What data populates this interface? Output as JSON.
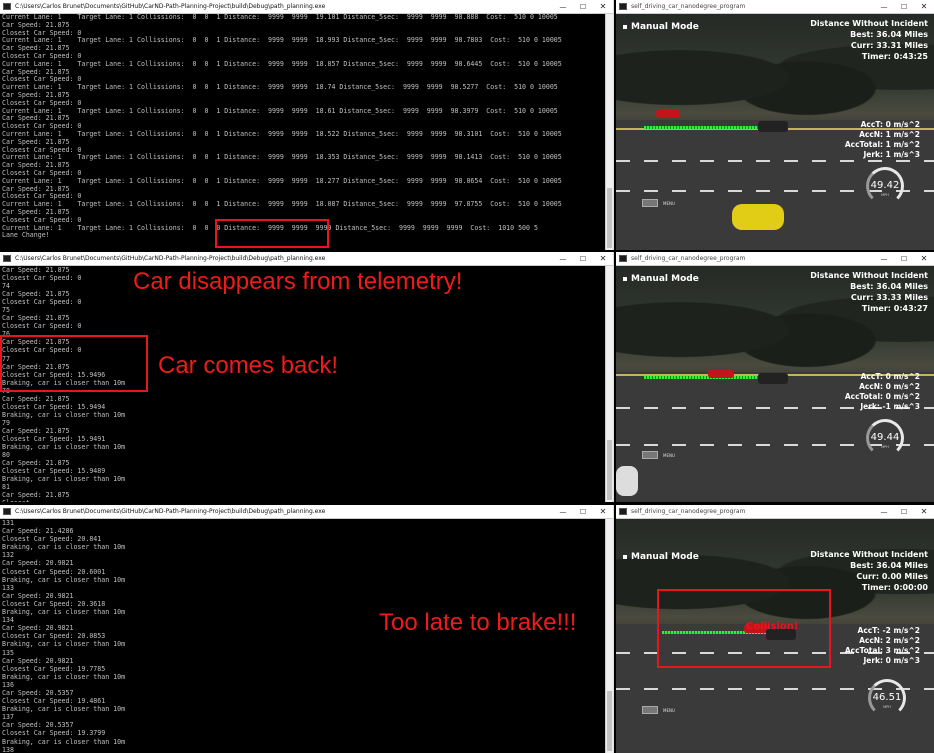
{
  "consoles": [
    {
      "title": "C:\\Users\\Carlos Brunet\\Documents\\GitHub\\CarND-Path-Planning-Project\\build\\Debug\\path_planning.exe",
      "lines": [
        "Current Lane: 1    Target Lane: 1 Collissions:  0  0  1 Distance:  9999  9999  19.101 Distance_5sec:  9999  9999  98.888  Cost:  510 0 10005",
        "Car Speed: 21.875",
        "Closest Car Speed: 0",
        "Current Lane: 1    Target Lane: 1 Collissions:  0  0  1 Distance:  9999  9999  18.993 Distance_5sec:  9999  9999  98.7803  Cost:  510 0 10005",
        "Car Speed: 21.875",
        "Closest Car Speed: 0",
        "Current Lane: 1    Target Lane: 1 Collissions:  0  0  1 Distance:  9999  9999  18.857 Distance_5sec:  9999  9999  98.6445  Cost:  510 0 10005",
        "Car Speed: 21.875",
        "Closest Car Speed: 0",
        "Current Lane: 1    Target Lane: 1 Collissions:  0  0  1 Distance:  9999  9999  18.74 Distance_5sec:  9999  9999  98.5277  Cost:  510 0 10005",
        "Car Speed: 21.875",
        "Closest Car Speed: 0",
        "Current Lane: 1    Target Lane: 1 Collissions:  0  0  1 Distance:  9999  9999  18.61 Distance_5sec:  9999  9999  98.3979  Cost:  510 0 10005",
        "Car Speed: 21.875",
        "Closest Car Speed: 0",
        "Current Lane: 1    Target Lane: 1 Collissions:  0  0  1 Distance:  9999  9999  18.522 Distance_5sec:  9999  9999  98.3101  Cost:  510 0 10005",
        "Car Speed: 21.875",
        "Closest Car Speed: 0",
        "Current Lane: 1    Target Lane: 1 Collissions:  0  0  1 Distance:  9999  9999  18.353 Distance_5sec:  9999  9999  98.1413  Cost:  510 0 10005",
        "Car Speed: 21.875",
        "Closest Car Speed: 0",
        "Current Lane: 1    Target Lane: 1 Collissions:  0  0  1 Distance:  9999  9999  18.277 Distance_5sec:  9999  9999  98.0654  Cost:  510 0 10005",
        "Car Speed: 21.875",
        "Closest Car Speed: 0",
        "Current Lane: 1    Target Lane: 1 Collissions:  0  0  1 Distance:  9999  9999  18.087 Distance_5sec:  9999  9999  97.8755  Cost:  510 0 10005",
        "Car Speed: 21.875",
        "Closest Car Speed: 0",
        "Current Lane: 1    Target Lane: 1 Collissions:  0  0  0 Distance:  9999  9999  9999 Distance_5sec:  9999  9999  9999  Cost:  1010 500 5",
        "Lane Change!"
      ]
    },
    {
      "title": "C:\\Users\\Carlos Brunet\\Documents\\GitHub\\CarND-Path-Planning-Project\\build\\Debug\\path_planning.exe",
      "lines": [
        "Car Speed: 21.875",
        "Closest Car Speed: 0",
        "74",
        "Car Speed: 21.875",
        "Closest Car Speed: 0",
        "75",
        "Car Speed: 21.875",
        "Closest Car Speed: 0",
        "76",
        "Car Speed: 21.875",
        "Closest Car Speed: 0",
        "77",
        "Car Speed: 21.875",
        "Closest Car Speed: 15.9496",
        "Braking, car is closer than 10m",
        "78",
        "Car Speed: 21.875",
        "Closest Car Speed: 15.9494",
        "Braking, car is closer than 10m",
        "79",
        "Car Speed: 21.875",
        "Closest Car Speed: 15.9491",
        "Braking, car is closer than 10m",
        "80",
        "Car Speed: 21.875",
        "Closest Car Speed: 15.9489",
        "Braking, car is closer than 10m",
        "81",
        "Car Speed: 21.875",
        "Closest"
      ]
    },
    {
      "title": "C:\\Users\\Carlos Brunet\\Documents\\GitHub\\CarND-Path-Planning-Project\\build\\Debug\\path_planning.exe",
      "lines": [
        "131",
        "Car Speed: 21.4286",
        "Closest Car Speed: 20.841",
        "Braking, car is closer than 10m",
        "132",
        "Car Speed: 20.9821",
        "Closest Car Speed: 20.6001",
        "Braking, car is closer than 10m",
        "133",
        "Car Speed: 20.9821",
        "Closest Car Speed: 20.3618",
        "Braking, car is closer than 10m",
        "134",
        "Car Speed: 20.9821",
        "Closest Car Speed: 20.0853",
        "Braking, car is closer than 10m",
        "135",
        "Car Speed: 20.9821",
        "Closest Car Speed: 19.7785",
        "Braking, car is closer than 10m",
        "136",
        "Car Speed: 20.5357",
        "Closest Car Speed: 19.4861",
        "Braking, car is closer than 10m",
        "137",
        "Car Speed: 20.5357",
        "Closest Car Speed: 19.3799",
        "Braking, car is closer than 10m",
        "138"
      ]
    }
  ],
  "sims": [
    {
      "title": "self_driving_car_nanodegree_program",
      "mode": "Manual Mode",
      "distance_label": "Distance Without Incident",
      "best": "Best: 36.04 Miles",
      "curr": "Curr: 33.31 Miles",
      "timer": "Timer: 0:43:25",
      "acct": "AccT: 0 m/s^2",
      "accn": "AccN: 1 m/s^2",
      "acctotal": "AccTotal: 1 m/s^2",
      "jerk": "Jerk: 1 m/s^3",
      "speed": "49.42",
      "speed_unit": "MPH",
      "menu": "MENU"
    },
    {
      "title": "self_driving_car_nanodegree_program",
      "mode": "Manual Mode",
      "distance_label": "Distance Without Incident",
      "best": "Best: 36.04 Miles",
      "curr": "Curr: 33.33 Miles",
      "timer": "Timer: 0:43:27",
      "acct": "AccT: 0 m/s^2",
      "accn": "AccN: 0 m/s^2",
      "acctotal": "AccTotal: 0 m/s^2",
      "jerk": "Jerk: -1 m/s^3",
      "speed": "49.44",
      "speed_unit": "MPH",
      "menu": "MENU"
    },
    {
      "title": "self_driving_car_nanodegree_program",
      "mode": "Manual Mode",
      "distance_label": "Distance Without Incident",
      "best": "Best: 36.04 Miles",
      "curr": "Curr: 0.00 Miles",
      "timer": "Timer: 0:00:00",
      "acct": "AccT: -2 m/s^2",
      "accn": "AccN: 2 m/s^2",
      "acctotal": "AccTotal: 3 m/s^2",
      "jerk": "Jerk: 0 m/s^3",
      "speed": "46.51",
      "speed_unit": "MPH",
      "menu": "MENU",
      "collision_text": "Collision!"
    }
  ],
  "annotations": {
    "disappears": "Car disappears from telemetry!",
    "comes_back": "Car comes back!",
    "too_late": "Too late to brake!!!"
  },
  "window_controls": {
    "minimize": "—",
    "maximize": "☐",
    "close": "✕"
  },
  "colors": {
    "annotation_red": "#ee1b1b",
    "path_green": "#2cf23a",
    "console_text": "#c0c0c0"
  }
}
